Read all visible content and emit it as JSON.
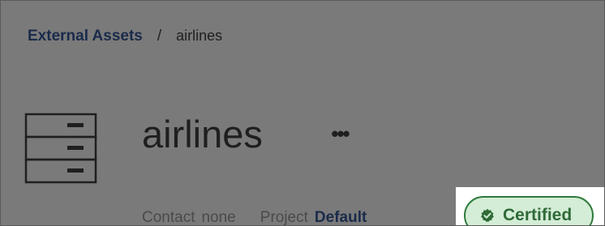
{
  "breadcrumb": {
    "parent": "External Assets",
    "separator": "/",
    "current": "airlines"
  },
  "asset": {
    "title": "airlines",
    "more_label": "•••",
    "icon": "datasource-icon"
  },
  "meta": {
    "contact_label": "Contact",
    "contact_value": "none",
    "project_label": "Project",
    "project_value": "Default"
  },
  "badge": {
    "label": "Certified",
    "icon": "check-badge-icon"
  },
  "colors": {
    "overlay": "#7a7a7a",
    "link": "#1a2b4a",
    "badge_border": "#2f7a3c",
    "badge_fill": "#d4edd6",
    "badge_text": "#2f6a38"
  }
}
